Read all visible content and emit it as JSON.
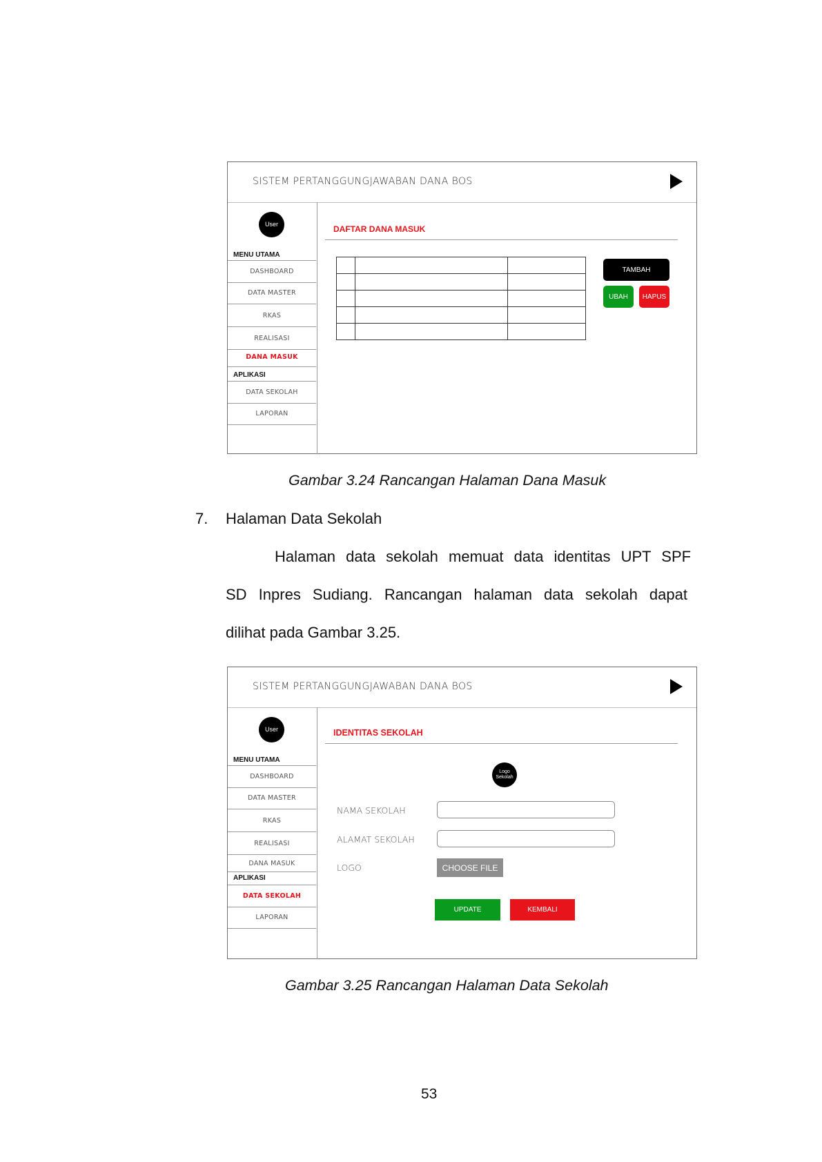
{
  "figure1": {
    "app_title": "SISTEM PERTANGGUNGJAWABAN DANA BOS",
    "avatar_label": "User",
    "menu_utama_label": "MENU UTAMA",
    "menu_utama_items": [
      "DASHBOARD",
      "DATA MASTER",
      "RKAS",
      "REALISASI",
      "DANA MASUK"
    ],
    "aplikasi_label": "APLIKASI",
    "aplikasi_items": [
      "DATA SEKOLAH",
      "LAPORAN"
    ],
    "active_item": "DANA MASUK",
    "content_heading": "DAFTAR DANA MASUK",
    "buttons": {
      "tambah": "TAMBAH",
      "ubah": "UBAH",
      "hapus": "HAPUS"
    },
    "caption": "Gambar 3.24 Rancangan Halaman Dana Masuk"
  },
  "section": {
    "number": "7.",
    "title": "Halaman Data Sekolah",
    "paragraph_lines": [
      "Halaman data sekolah memuat data identitas UPT SPF",
      "SD Inpres Sudiang. Rancangan halaman data sekolah dapat",
      "dilihat pada Gambar 3.25."
    ]
  },
  "figure2": {
    "app_title": "SISTEM PERTANGGUNGJAWABAN DANA BOS",
    "avatar_label": "User",
    "menu_utama_label": "MENU UTAMA",
    "menu_utama_items": [
      "DASHBOARD",
      "DATA MASTER",
      "RKAS",
      "REALISASI",
      "DANA MASUK"
    ],
    "aplikasi_label": "APLIKASI",
    "aplikasi_items": [
      "DATA SEKOLAH",
      "LAPORAN"
    ],
    "active_item": "DATA SEKOLAH",
    "content_heading": "IDENTITAS SEKOLAH",
    "logo_placeholder": "Logo Sekolah",
    "form": {
      "nama_label": "NAMA SEKOLAH",
      "alamat_label": "ALAMAT SEKOLAH",
      "logo_label": "LOGO",
      "choose_file": "CHOOSE FILE"
    },
    "buttons": {
      "update": "UPDATE",
      "kembali": "KEMBALI"
    },
    "caption": "Gambar 3.25 Rancangan Halaman Data Sekolah"
  },
  "page_number": "53",
  "colors": {
    "accent_red": "#e8141c",
    "green": "#0a9a1e",
    "black": "#000000",
    "grey": "#8e8e8e"
  }
}
